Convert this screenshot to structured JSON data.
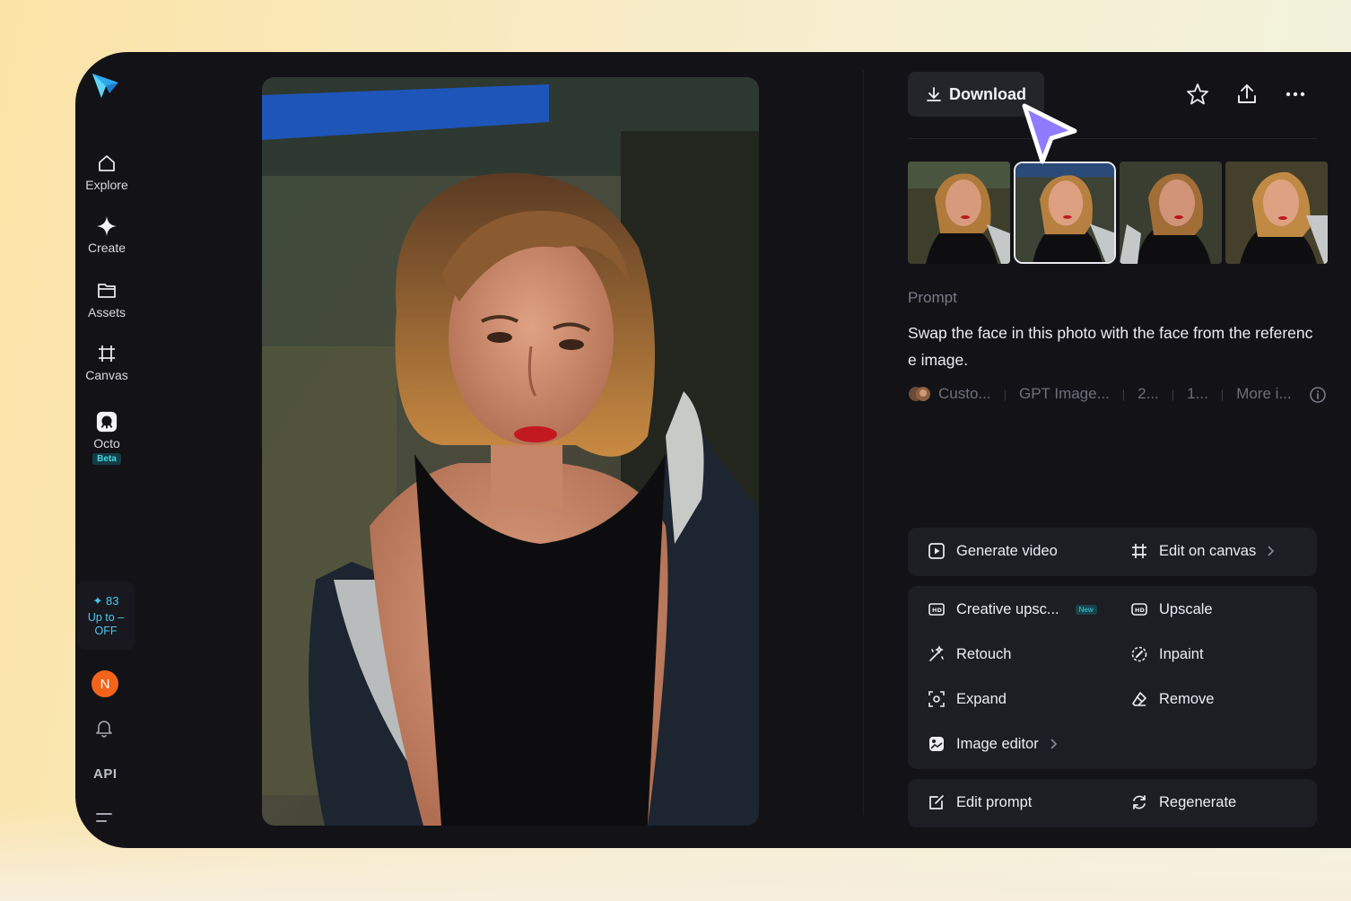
{
  "sidebar": {
    "nav": [
      {
        "label": "Explore",
        "icon": "home-icon"
      },
      {
        "label": "Create",
        "icon": "sparkle-icon"
      },
      {
        "label": "Assets",
        "icon": "folder-icon"
      },
      {
        "label": "Canvas",
        "icon": "crop-icon"
      },
      {
        "label": "Octo",
        "icon": "octo-icon",
        "badge": "Beta"
      }
    ],
    "credits": {
      "count": "83",
      "promo_line1": "Up to –",
      "promo_line2": "OFF"
    },
    "avatar_initial": "N",
    "api_label": "API"
  },
  "toolbar": {
    "download_label": "Download"
  },
  "prompt": {
    "label": "Prompt",
    "text": "Swap the face in this photo with the face from the reference image.",
    "meta": [
      "Custo...",
      "GPT Image...",
      "2...",
      "1...",
      "More i..."
    ]
  },
  "actions": {
    "card1": [
      "Generate video",
      "Edit on canvas"
    ],
    "card2": [
      "Creative upsc...",
      "Upscale",
      "Retouch",
      "Inpaint",
      "Expand",
      "Remove",
      "Image editor"
    ],
    "card2_new_badge": "New",
    "card3": [
      "Edit prompt",
      "Regenerate"
    ]
  },
  "colors": {
    "app_bg": "#121217",
    "card_bg": "#1d1d24",
    "accent_cyan": "#47d7e6",
    "cursor": "#8f7bff",
    "avatar": "#f26419"
  }
}
